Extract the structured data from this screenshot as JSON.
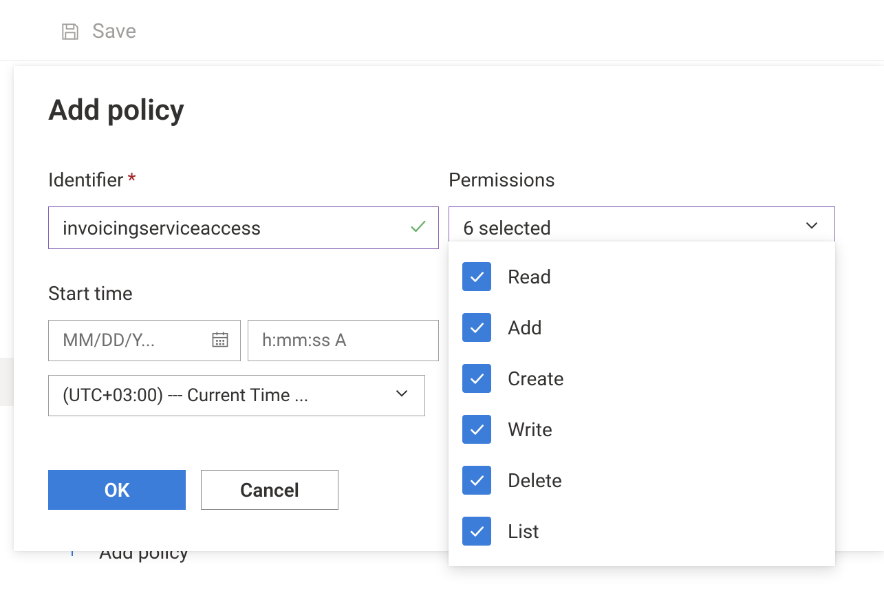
{
  "toolbar": {
    "save_label": "Save"
  },
  "panel": {
    "title": "Add policy",
    "identifier_label": "Identifier",
    "identifier_value": "invoicingserviceaccess",
    "start_time_label": "Start time",
    "date_placeholder": "MM/DD/Y...",
    "time_placeholder": "h:mm:ss A",
    "timezone_value": "(UTC+03:00) --- Current Time ...",
    "ok_label": "OK",
    "cancel_label": "Cancel"
  },
  "permissions": {
    "label": "Permissions",
    "summary": "6 selected",
    "options": [
      {
        "label": "Read",
        "checked": true
      },
      {
        "label": "Add",
        "checked": true
      },
      {
        "label": "Create",
        "checked": true
      },
      {
        "label": "Write",
        "checked": true
      },
      {
        "label": "Delete",
        "checked": true
      },
      {
        "label": "List",
        "checked": true
      }
    ]
  },
  "behind": {
    "add_policy_label": "Add policy"
  }
}
